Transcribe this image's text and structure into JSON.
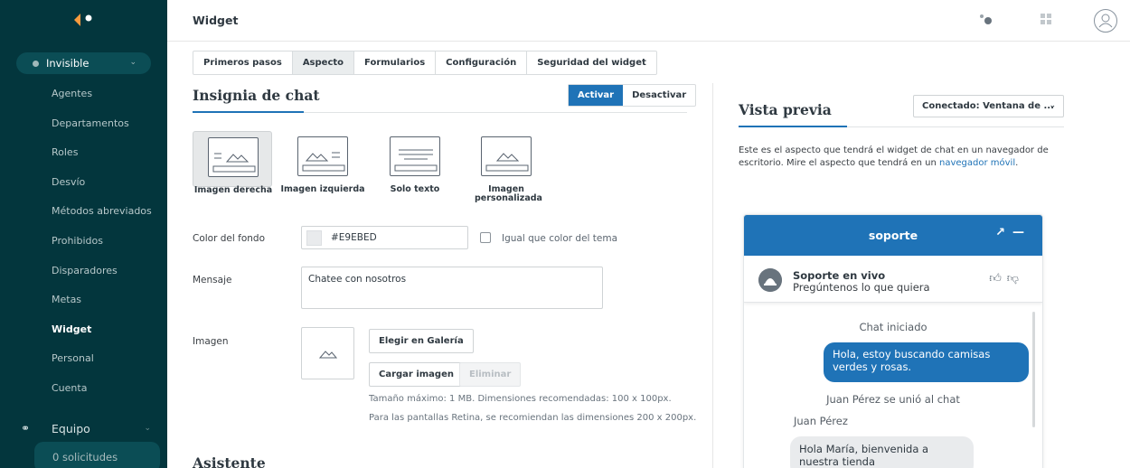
{
  "app": {
    "status": "Invisible",
    "nav_items": [
      "Agentes",
      "Departamentos",
      "Roles",
      "Desvío",
      "Métodos abreviados",
      "Prohibidos",
      "Disparadores",
      "Metas",
      "Widget",
      "Personal",
      "Cuenta"
    ],
    "active_nav": "Widget",
    "team_label": "Equipo",
    "requests_label": "0 solicitudes"
  },
  "header": {
    "title": "Widget"
  },
  "tabs": [
    {
      "label": "Primeros pasos",
      "active": false
    },
    {
      "label": "Aspecto",
      "active": true
    },
    {
      "label": "Formularios",
      "active": false
    },
    {
      "label": "Configuración",
      "active": false
    },
    {
      "label": "Seguridad del widget",
      "active": false
    }
  ],
  "badge_section": {
    "title": "Insignia de chat",
    "activate_label": "Activar",
    "deactivate_label": "Desactivar",
    "options": [
      {
        "label": "Imagen derecha",
        "selected": true
      },
      {
        "label": "Imagen izquierda",
        "selected": false
      },
      {
        "label": "Solo texto",
        "selected": false
      },
      {
        "label": "Imagen personalizada",
        "selected": false
      }
    ]
  },
  "form": {
    "bg_color_label": "Color del fondo",
    "bg_color_value": "#E9EBED",
    "same_as_theme_label": "Igual que color del tema",
    "message_label": "Mensaje",
    "message_value": "Chatee con nosotros",
    "image_label": "Imagen",
    "gallery_button": "Elegir en Galería",
    "upload_button": "Cargar imagen",
    "remove_button": "Eliminar",
    "hint_1": "Tamaño máximo: 1 MB. Dimensiones recomendadas: 100 x 100px.",
    "hint_2": "Para las pantallas Retina, se recomiendan las dimensiones 200 x 200px."
  },
  "assistant": {
    "title": "Asistente"
  },
  "preview": {
    "title": "Vista previa",
    "select_value": "Conectado: Ventana de ...",
    "description": "Este es el aspecto que tendrá el widget de chat en un navegador de escritorio. Mire el aspecto que tendrá en un",
    "mobile_link": "navegador móvil",
    "chat": {
      "header_title": "soporte",
      "agent_title": "Soporte en vivo",
      "agent_subtitle": "Pregúntenos lo que quiera",
      "started": "Chat iniciado",
      "visitor_msg": "Hola, estoy buscando camisas verdes y rosas.",
      "joined": "Juan Pérez se unió al chat",
      "agent_name": "Juan Pérez",
      "agent_msg": "Hola María, bienvenida a nuestra tienda"
    }
  },
  "colors": {
    "sidebar_bg": "#03363d",
    "accent": "#1f73b7",
    "logo_orange": "#f79a3e"
  },
  "icons": [
    "zendesk-logo-icon",
    "status-dot-icon",
    "chevron-down-icon",
    "team-icon",
    "chat-status-icon",
    "apps-grid-icon",
    "user-avatar-icon",
    "mountain-image-icon",
    "popout-icon",
    "minimize-icon",
    "thumbs-up-icon",
    "thumbs-down-icon"
  ]
}
